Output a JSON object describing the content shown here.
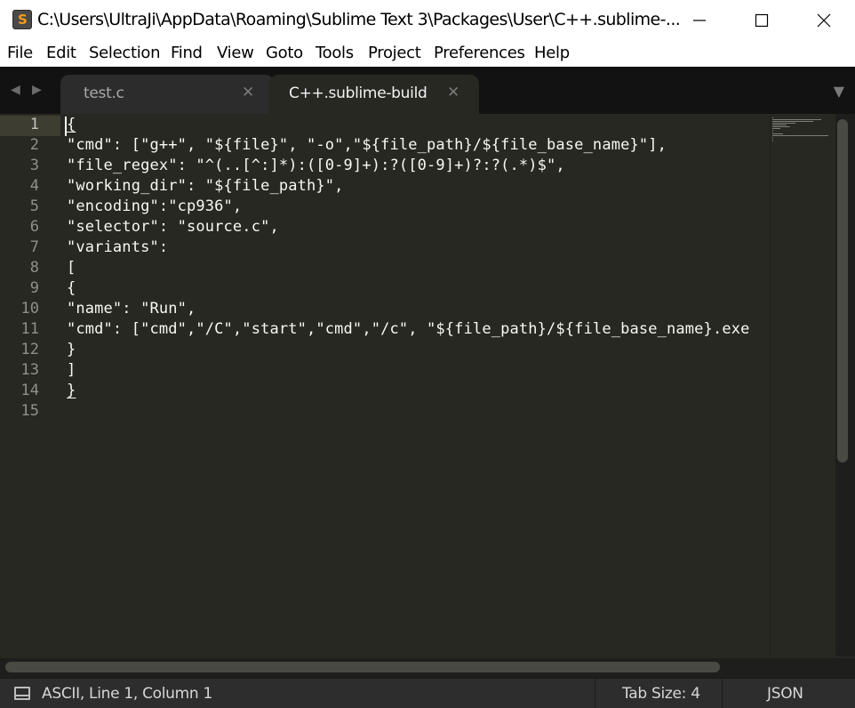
{
  "window": {
    "title": "C:\\Users\\UltraJi\\AppData\\Roaming\\Sublime Text 3\\Packages\\User\\C++.sublime-...",
    "app_icon_letter": "S"
  },
  "menu": [
    "File",
    "Edit",
    "Selection",
    "Find",
    "View",
    "Goto",
    "Tools",
    "Project",
    "Preferences",
    "Help"
  ],
  "tabs": [
    {
      "label": "test.c",
      "active": false
    },
    {
      "label": "C++.sublime-build",
      "active": true
    }
  ],
  "editor": {
    "lines": [
      "{",
      "\"cmd\": [\"g++\", \"${file}\", \"-o\",\"${file_path}/${file_base_name}\"],",
      "\"file_regex\": \"^(..[^:]*):([0-9]+):?([0-9]+)?:?(.*)$\",",
      "\"working_dir\": \"${file_path}\",",
      "\"encoding\":\"cp936\",",
      "\"selector\": \"source.c\",",
      "\"variants\":",
      "[",
      "{",
      "\"name\": \"Run\",",
      "\"cmd\": [\"cmd\",\"/C\",\"start\",\"cmd\",\"/c\", \"${file_path}/${file_base_name}.exe",
      "}",
      "]",
      "}",
      ""
    ],
    "current_line": 1,
    "text_color": "#f8f8f2",
    "background_color": "#272822"
  },
  "status": {
    "position": "ASCII, Line 1, Column 1",
    "tab_size": "Tab Size: 4",
    "syntax": "JSON"
  },
  "icons": {
    "nav_back": "left-triangle-icon",
    "nav_forward": "right-triangle-icon",
    "tab_close": "close-x-icon",
    "tab_dropdown": "down-triangle-icon",
    "panel_toggle": "panel-icon"
  }
}
